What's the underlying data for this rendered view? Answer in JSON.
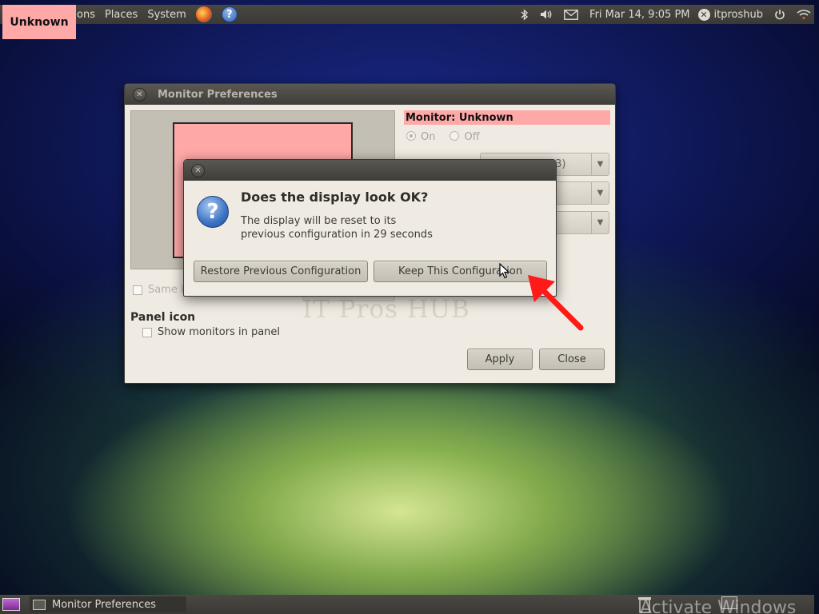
{
  "badge": {
    "label": "Unknown"
  },
  "top_panel": {
    "menus": [
      "ons",
      "Places",
      "System"
    ],
    "launchers": [
      "firefox-icon",
      "help-icon"
    ],
    "help_glyph": "?",
    "tray_icons": [
      "bluetooth-icon",
      "volume-icon",
      "mail-icon"
    ],
    "clock": "Fri Mar 14,  9:05 PM",
    "user": "itproshub",
    "user_glyph": "✕",
    "power_icon": "power-icon",
    "network_icon": "wifi-icon"
  },
  "monitor_window": {
    "title": "Monitor Preferences",
    "monitor_label": "Monitor: Unknown",
    "on_label": "On",
    "off_label": "Off",
    "combo_1_value": "(3)",
    "combo_1_prefix": "...",
    "same_image_label": "Same i",
    "panel_icon_heading": "Panel icon",
    "show_monitors_label": "Show monitors in panel",
    "apply_label": "Apply",
    "close_label": "Close",
    "watermark": "IT Pros HUB"
  },
  "confirm_dialog": {
    "heading": "Does the display look OK?",
    "message_line1": "The display will be reset to its",
    "message_line2": "previous configuration in 29 seconds",
    "question_glyph": "?",
    "restore_label": "Restore Previous Configuration",
    "keep_label": "Keep This Configuration"
  },
  "bottom_panel": {
    "task_label": "Monitor Preferences",
    "activate_text": "Activate Windows"
  },
  "colors": {
    "highlight_pink": "#ffa8a8",
    "annotation_red": "#ff1a1a",
    "panel_dark": "#3a3935",
    "window_bg": "#f0ebe2"
  }
}
